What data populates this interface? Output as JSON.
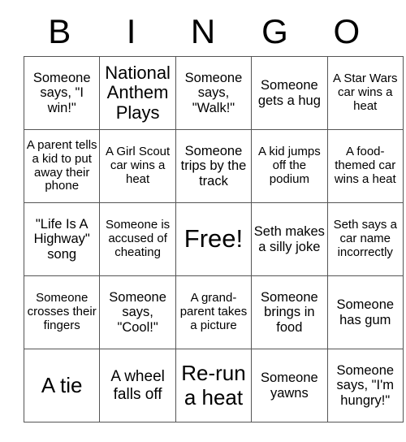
{
  "card": {
    "title": "BINGO",
    "header_letters": [
      "B",
      "I",
      "N",
      "G",
      "O"
    ],
    "columns": 5,
    "rows": 5,
    "free_space": {
      "row": 2,
      "col": 2,
      "label": "Free!"
    },
    "border_color": "#555555",
    "text_color": "#000000",
    "background_color": "#ffffff",
    "cells": [
      {
        "text": "Someone says, \"I win!\"",
        "size": "m"
      },
      {
        "text": "National Anthem Plays",
        "size": "xl"
      },
      {
        "text": "Someone says, \"Walk!\"",
        "size": "m"
      },
      {
        "text": "Someone gets a hug",
        "size": "m"
      },
      {
        "text": "A Star Wars car wins a heat",
        "size": "s"
      },
      {
        "text": "A parent tells a kid to put away their phone",
        "size": "s"
      },
      {
        "text": "A Girl Scout car wins a heat",
        "size": "s"
      },
      {
        "text": "Someone trips by the track",
        "size": "m"
      },
      {
        "text": "A kid jumps off the podium",
        "size": "s"
      },
      {
        "text": "A food-themed car wins a heat",
        "size": "s"
      },
      {
        "text": "\"Life Is A Highway\" song",
        "size": "m"
      },
      {
        "text": "Someone is accused of cheating",
        "size": "s"
      },
      {
        "text": "Free!",
        "size": "free"
      },
      {
        "text": "Seth makes a silly joke",
        "size": "m"
      },
      {
        "text": "Seth says a car name incorrectly",
        "size": "s"
      },
      {
        "text": "Someone crosses their fingers",
        "size": "s"
      },
      {
        "text": "Someone says, \"Cool!\"",
        "size": "m"
      },
      {
        "text": "A grand-parent takes a picture",
        "size": "s"
      },
      {
        "text": "Someone brings in food",
        "size": "m"
      },
      {
        "text": "Someone has gum",
        "size": "m"
      },
      {
        "text": "A tie",
        "size": "xxl"
      },
      {
        "text": "A wheel falls off",
        "size": "l"
      },
      {
        "text": "Re-run a heat",
        "size": "xxl"
      },
      {
        "text": "Someone yawns",
        "size": "m"
      },
      {
        "text": "Someone says, \"I'm hungry!\"",
        "size": "m"
      }
    ]
  }
}
